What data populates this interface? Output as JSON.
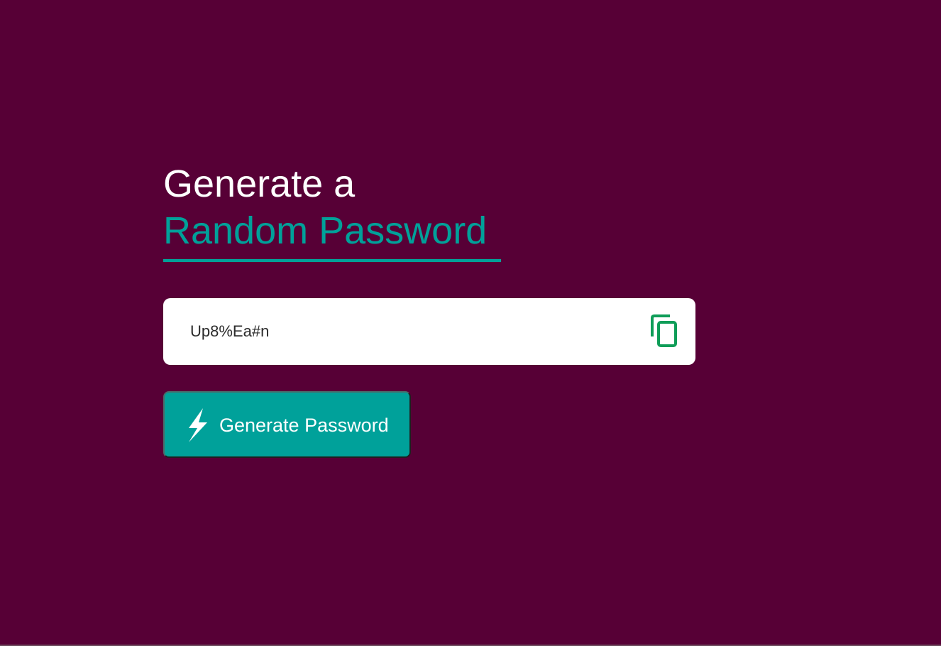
{
  "heading": {
    "line1": "Generate a",
    "line2": "Random Password"
  },
  "password": {
    "value": "Up8%Ea#n",
    "copy_icon": "copy-icon"
  },
  "generate_button": {
    "label": "Generate Password",
    "icon": "lightning-bolt-icon"
  },
  "colors": {
    "background": "#570036",
    "accent": "#00a19a",
    "heading_text": "#ffffff",
    "copy_icon": "#0f9d58"
  }
}
